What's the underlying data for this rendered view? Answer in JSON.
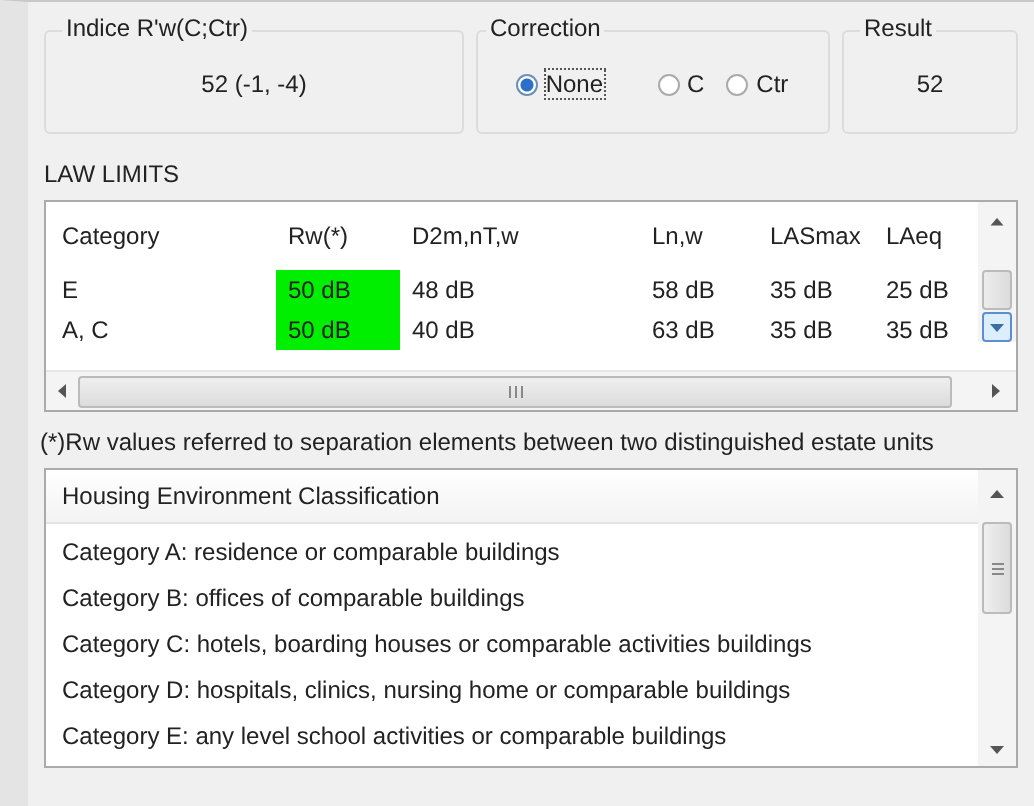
{
  "index_group": {
    "title": "Indice R'w(C;Ctr)",
    "value": "52 (-1, -4)"
  },
  "correction_group": {
    "title": "Correction",
    "options": [
      {
        "label": "None",
        "selected": true
      },
      {
        "label": "C",
        "selected": false
      },
      {
        "label": "Ctr",
        "selected": false
      }
    ]
  },
  "result_group": {
    "title": "Result",
    "value": "52"
  },
  "law_limits": {
    "title": "LAW LIMITS",
    "table": {
      "columns": [
        "Category",
        "Rw(*)",
        "D2m,nT,w",
        "Ln,w",
        "LASmax",
        "LAeq"
      ],
      "rows": [
        {
          "cells": [
            "E",
            {
              "text": "50 dB",
              "color": "#00ee00"
            },
            "48 dB",
            "58 dB",
            "35 dB",
            "25 dB"
          ]
        },
        {
          "cells": [
            "A, C",
            {
              "text": "50 dB",
              "color": "#00ee00"
            },
            "40 dB",
            "63 dB",
            "35 dB",
            "35 dB"
          ]
        }
      ]
    },
    "footnote": "(*)Rw values referred to separation elements between two distinguished estate units"
  },
  "classification_list": {
    "header": "Housing Environment Classification",
    "items": [
      "Category A: residence or comparable buildings",
      "Category B: offices of comparable buildings",
      "Category C: hotels, boarding houses or comparable activities buildings",
      "Category D: hospitals, clinics, nursing home or comparable buildings",
      "Category E: any level school activities or comparable buildings"
    ]
  }
}
